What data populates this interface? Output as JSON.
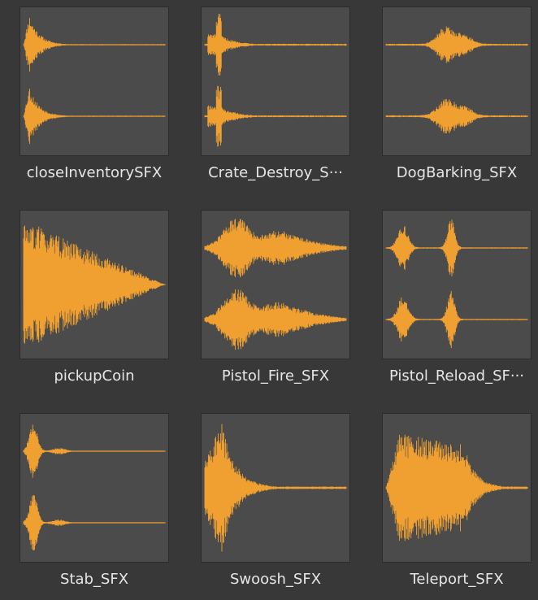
{
  "assets": [
    {
      "name": "closeInventorySFX",
      "waveform": "close-inventory",
      "channels": 2
    },
    {
      "name": "Crate_Destroy_S···",
      "waveform": "crate-destroy",
      "channels": 2
    },
    {
      "name": "DogBarking_SFX",
      "waveform": "dog-barking",
      "channels": 2
    },
    {
      "name": "pickupCoin",
      "waveform": "pickup-coin",
      "channels": 1
    },
    {
      "name": "Pistol_Fire_SFX",
      "waveform": "pistol-fire",
      "channels": 2
    },
    {
      "name": "Pistol_Reload_SF···",
      "waveform": "pistol-reload",
      "channels": 2
    },
    {
      "name": "Stab_SFX",
      "waveform": "stab",
      "channels": 2
    },
    {
      "name": "Swoosh_SFX",
      "waveform": "swoosh",
      "channels": 1
    },
    {
      "name": "Teleport_SFX",
      "waveform": "teleport",
      "channels": 1
    }
  ],
  "colors": {
    "background": "#383838",
    "thumbnail": "#4b4b4b",
    "waveform": "#f0a030",
    "label": "#e6e6e6"
  }
}
